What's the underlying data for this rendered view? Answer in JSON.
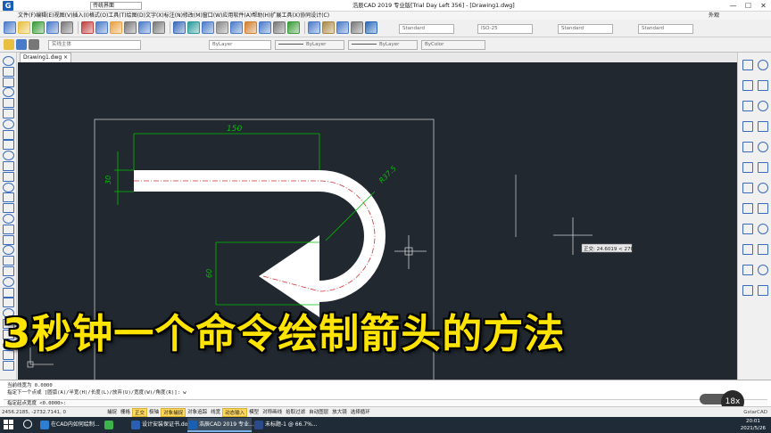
{
  "window": {
    "title": "浩辰CAD 2019 专业版[Trial Day Left 356] - [Drawing1.dwg]",
    "workspace_select": "传统界面",
    "workspace_label": "外观",
    "min_label": "—",
    "max_label": "☐",
    "close_label": "✕",
    "logo": "G"
  },
  "menu": [
    "文件(F)",
    "编辑(E)",
    "视图(V)",
    "插入(I)",
    "格式(O)",
    "工具(T)",
    "绘图(D)",
    "文字(X)",
    "标注(N)",
    "修改(M)",
    "窗口(W)",
    "应用软件(A)",
    "帮助(H)",
    "扩展工具(X)",
    "协同设计(C)"
  ],
  "toolbar": {
    "textstyle": "Standard",
    "dimstyle": "ISO-25",
    "tablestyle": "Standard",
    "mleaderstyle": "Standard",
    "layer": "实线主体",
    "color": "ByLayer",
    "linetype": "ByLayer",
    "lineweight": "ByLayer",
    "plotstyle": "ByColor"
  },
  "tab": {
    "label": "Drawing1.dwg",
    "close": "×"
  },
  "drawing": {
    "dim_length": "150",
    "dim_height": "30",
    "dim_radius": "R37.5",
    "dim_arrow": "60",
    "tooltip": "正交: 24.6019 < 270°"
  },
  "caption": "3秒钟一个命令绘制箭头的方法",
  "command": {
    "lines": [
      "当前线宽为 0.0000",
      "指定下一个点或 [圆弧(A)/半宽(H)/长度(L)/放弃(U)/宽度(W)/角度(R)]: w",
      "指定起点宽度 <0.0000>:"
    ]
  },
  "zoom": "18x",
  "status": {
    "coords": "2456.2185, -2732.7141, 0",
    "buttons": [
      {
        "label": "捕捉",
        "on": false
      },
      {
        "label": "栅格",
        "on": false
      },
      {
        "label": "正交",
        "on": true
      },
      {
        "label": "极轴",
        "on": false
      },
      {
        "label": "对象捕捉",
        "on": true
      },
      {
        "label": "对象追踪",
        "on": false
      },
      {
        "label": "线宽",
        "on": false
      },
      {
        "label": "动态输入",
        "on": true
      },
      {
        "label": "模型",
        "on": false
      },
      {
        "label": "对称画线",
        "on": false
      },
      {
        "label": "拾取过滤",
        "on": false
      },
      {
        "label": "自动图层",
        "on": false
      },
      {
        "label": "放大镜",
        "on": false
      },
      {
        "label": "选择循环",
        "on": false
      }
    ],
    "brand": "GstarCAD"
  },
  "taskbar": {
    "tasks": [
      {
        "label": "在CAD内如何绘制...",
        "color": "#2d7dd2"
      },
      {
        "label": "",
        "color": "#3bb34a"
      },
      {
        "label": "设计安装保证书.do...",
        "color": "#2b5fb4"
      },
      {
        "label": "浩辰CAD 2019 专业...",
        "color": "#1a5fb4"
      },
      {
        "label": "未标题-1 @ 66.7%...",
        "color": "#2a4a8a"
      }
    ],
    "time": "20:01",
    "date": "2021/5/26"
  },
  "colors": {
    "canvas": "#212830",
    "dimension": "#00c000",
    "centerline": "#d03030",
    "caption": "#ffe400"
  }
}
